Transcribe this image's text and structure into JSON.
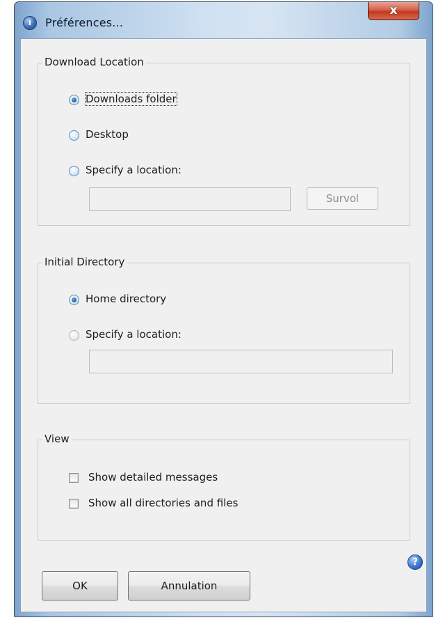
{
  "window": {
    "title": "Préférences...",
    "app_icon": "info-app-icon",
    "close_label": "x"
  },
  "download_location": {
    "legend": "Download Location",
    "options": [
      {
        "label": "Downloads folder",
        "checked": true
      },
      {
        "label": "Desktop",
        "checked": false
      },
      {
        "label": "Specify a location:",
        "checked": false
      }
    ],
    "path_value": "",
    "browse_label": "Survol"
  },
  "initial_directory": {
    "legend": "Initial Directory",
    "options": [
      {
        "label": "Home directory",
        "checked": true
      },
      {
        "label": "Specify a location:",
        "checked": false
      }
    ],
    "path_value": ""
  },
  "view": {
    "legend": "View",
    "options": [
      {
        "label": "Show detailed messages",
        "checked": false
      },
      {
        "label": "Show all directories and files",
        "checked": false
      }
    ]
  },
  "footer": {
    "ok_label": "OK",
    "cancel_label": "Annulation",
    "help_icon_glyph": "?"
  },
  "colors": {
    "title_bar": "#b5cde6",
    "close_button": "#c7432a",
    "dialog_bg": "#f0f0f0",
    "radio_checked": "#1f5c9a"
  }
}
